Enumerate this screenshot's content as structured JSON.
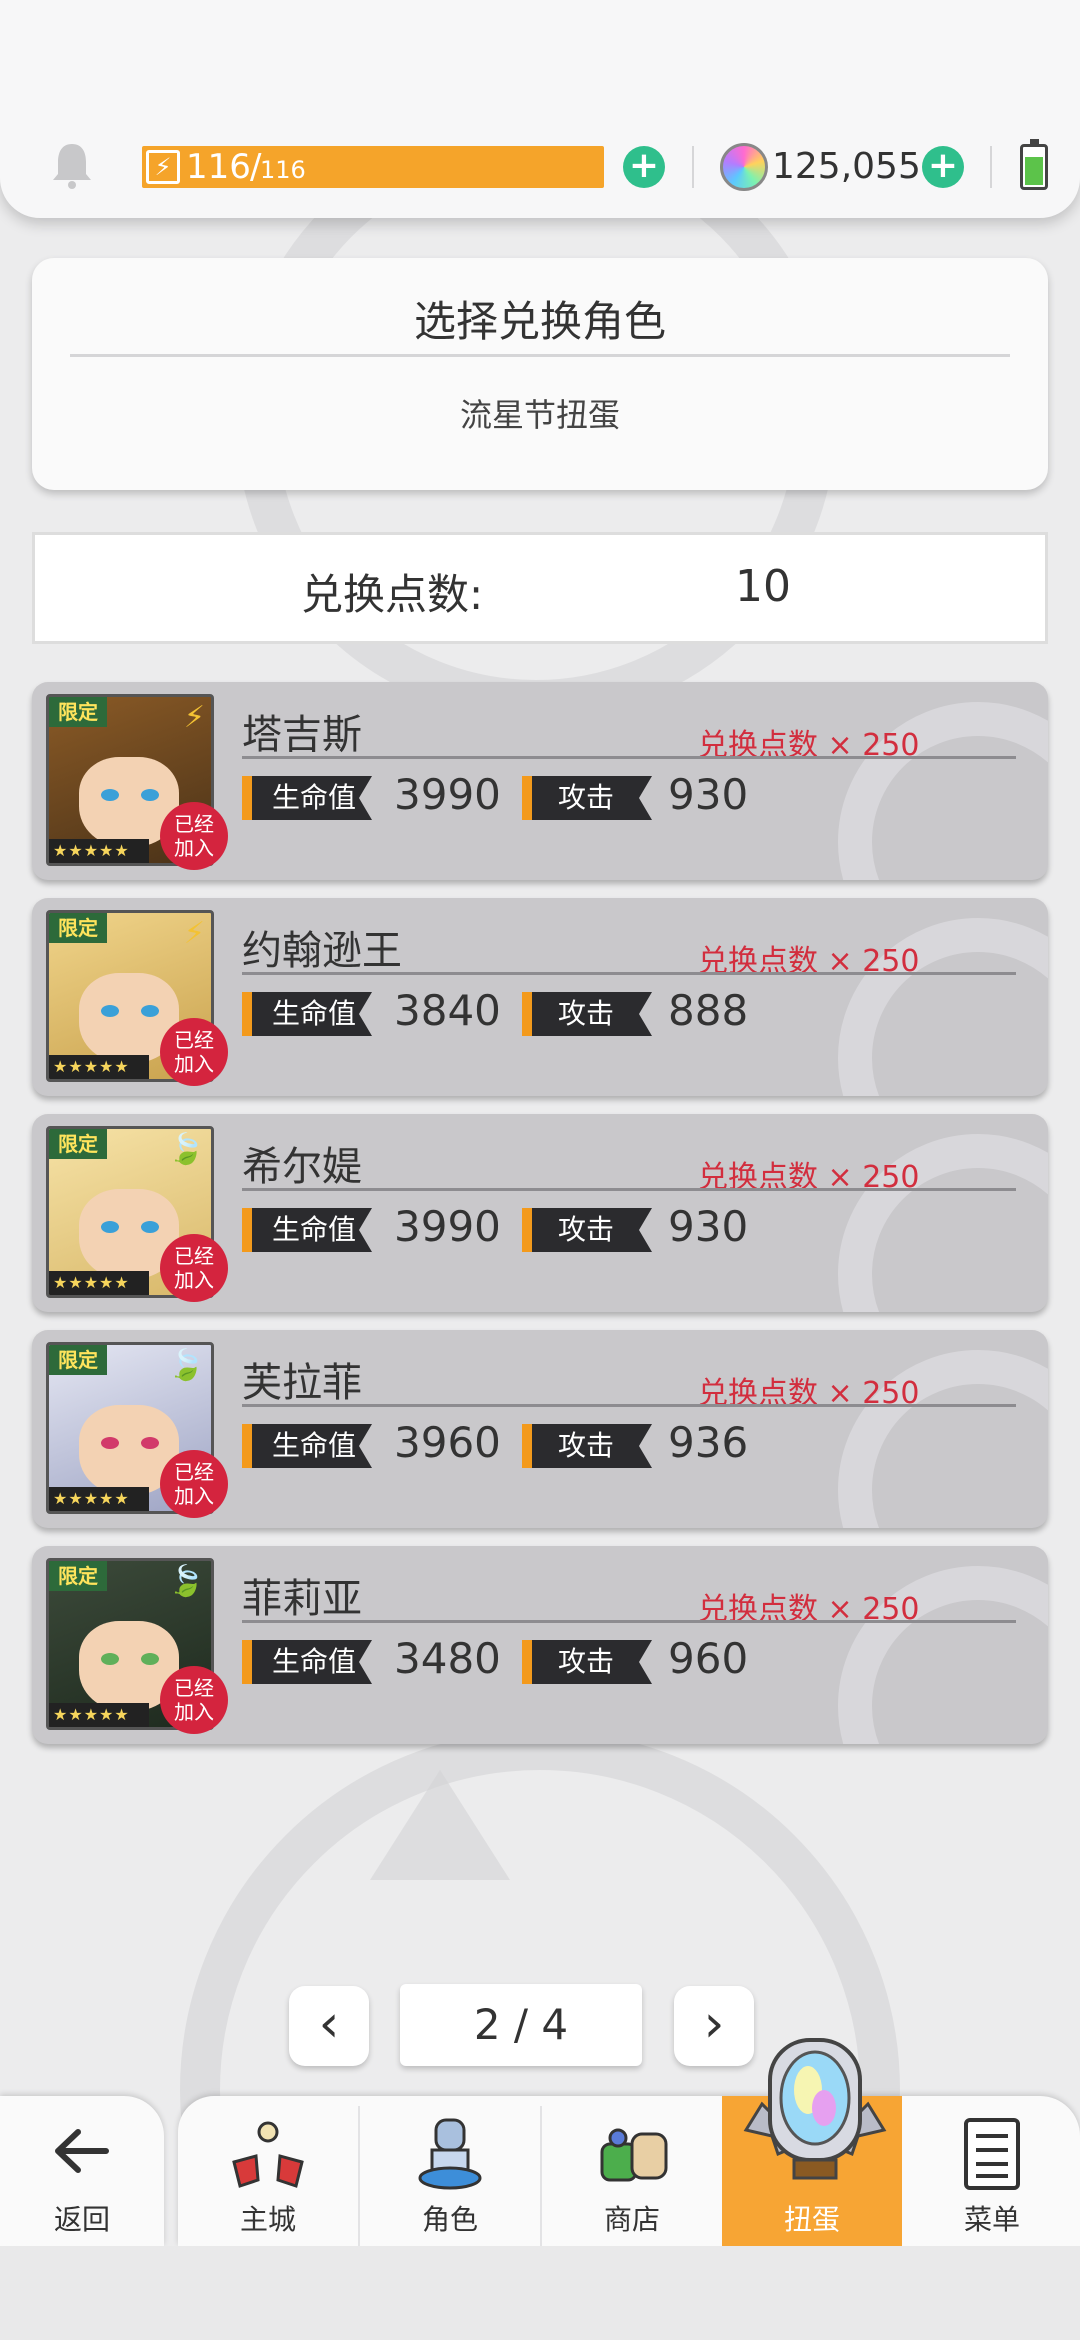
{
  "status": {
    "stamina_current": "116",
    "stamina_sep": "/",
    "stamina_max": "116",
    "gems": "125,055",
    "stamina_fill": 1.0,
    "battery_level": 0.65
  },
  "header": {
    "title": "选择兑换角色",
    "subtitle": "流星节扭蛋"
  },
  "points": {
    "label": "兑换点数:",
    "value": "10"
  },
  "characters": [
    {
      "name": "塔吉斯",
      "cost": "兑换点数 × 250",
      "hp_label": "生命值",
      "hp": "3990",
      "atk_label": "攻击",
      "atk": "930",
      "limited": "限定",
      "joined": "已经加入",
      "element": "lightning"
    },
    {
      "name": "约翰逊王",
      "cost": "兑换点数 × 250",
      "hp_label": "生命值",
      "hp": "3840",
      "atk_label": "攻击",
      "atk": "888",
      "limited": "限定",
      "joined": "已经加入",
      "element": "lightning"
    },
    {
      "name": "希尔媞",
      "cost": "兑换点数 × 250",
      "hp_label": "生命值",
      "hp": "3990",
      "atk_label": "攻击",
      "atk": "930",
      "limited": "限定",
      "joined": "已经加入",
      "element": "wind"
    },
    {
      "name": "芙拉菲",
      "cost": "兑换点数 × 250",
      "hp_label": "生命值",
      "hp": "3960",
      "atk_label": "攻击",
      "atk": "936",
      "limited": "限定",
      "joined": "已经加入",
      "element": "wind"
    },
    {
      "name": "菲莉亚",
      "cost": "兑换点数 × 250",
      "hp_label": "生命值",
      "hp": "3480",
      "atk_label": "攻击",
      "atk": "960",
      "limited": "限定",
      "joined": "已经加入",
      "element": "wind"
    }
  ],
  "pager": {
    "prev": "‹",
    "next": "›",
    "label": "2 / 4"
  },
  "nav": {
    "back": "返回",
    "items": [
      "主城",
      "角色",
      "商店",
      "扭蛋",
      "菜单"
    ],
    "active": "扭蛋"
  },
  "colors": {
    "accent_orange": "#f7a534",
    "plus_green": "#2fbf8c",
    "cost_red": "#d22e3e",
    "joined_red": "#d4243e"
  },
  "icons": {
    "bell": "bell-icon",
    "lightning": "lightning-icon",
    "wind": "leaf-icon",
    "back": "arrow-left-icon"
  }
}
